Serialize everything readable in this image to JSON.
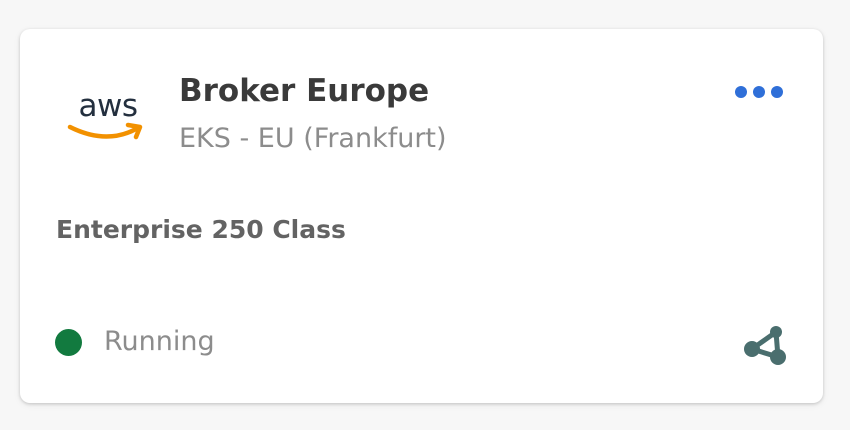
{
  "card": {
    "logo": {
      "text": "aws",
      "icon": "aws-logo"
    },
    "title": "Broker Europe",
    "subtitle": "EKS - EU (Frankfurt)",
    "menu_icon": "more-horizontal-icon",
    "plan": "Enterprise 250 Class",
    "status": {
      "label": "Running",
      "color": "#127a3f"
    },
    "share_icon": "share-network-icon"
  },
  "colors": {
    "accent": "#2f6fd8",
    "status_running": "#127a3f",
    "aws_orange": "#f29100",
    "aws_navy": "#232f3e",
    "share_icon": "#4a6e6e"
  }
}
